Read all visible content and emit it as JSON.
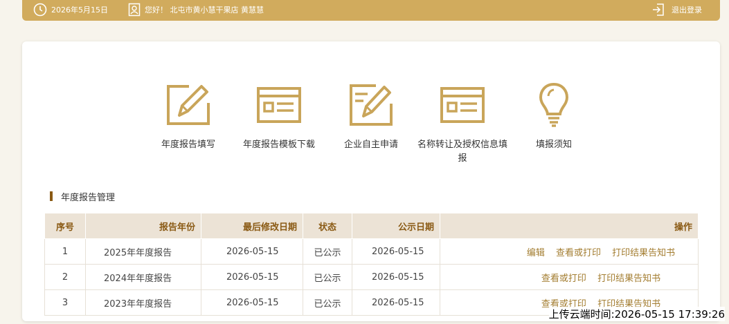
{
  "topbar": {
    "date": "2026年5月15日",
    "greeting": "您好！ 北屯市黄小慧干果店 黄慧慧",
    "logout": "退出登录"
  },
  "functions": [
    {
      "label": "年度报告填写",
      "icon": "pencil-form-icon"
    },
    {
      "label": "年度报告模板下载",
      "icon": "template-form-icon"
    },
    {
      "label": "企业自主申请",
      "icon": "edit-document-icon"
    },
    {
      "label": "名称转让及授权信息填报",
      "icon": "info-form-icon"
    },
    {
      "label": "填报须知",
      "icon": "lightbulb-icon"
    }
  ],
  "section": {
    "title": "年度报告管理"
  },
  "table": {
    "headers": [
      "序号",
      "报告年份",
      "最后修改日期",
      "状态",
      "公示日期",
      "操作"
    ],
    "rows": [
      {
        "no": "1",
        "year": "2025年年度报告",
        "modified": "2026-05-15",
        "status": "已公示",
        "published": "2026-05-15",
        "ops": [
          "编辑",
          "查看或打印",
          "打印结果告知书"
        ]
      },
      {
        "no": "2",
        "year": "2024年年度报告",
        "modified": "2026-05-15",
        "status": "已公示",
        "published": "2026-05-15",
        "ops": [
          "查看或打印",
          "打印结果告知书"
        ]
      },
      {
        "no": "3",
        "year": "2023年年度报告",
        "modified": "2026-05-15",
        "status": "已公示",
        "published": "2026-05-15",
        "ops": [
          "查看或打印",
          "打印结果告知书"
        ]
      }
    ]
  },
  "watermark": "上传云端时间:2026-05-15 17:39:26",
  "colors": {
    "brand": "#d1ab5d",
    "accent": "#8a5a14",
    "link": "#a37d30",
    "header_bg": "#ece3d6"
  }
}
